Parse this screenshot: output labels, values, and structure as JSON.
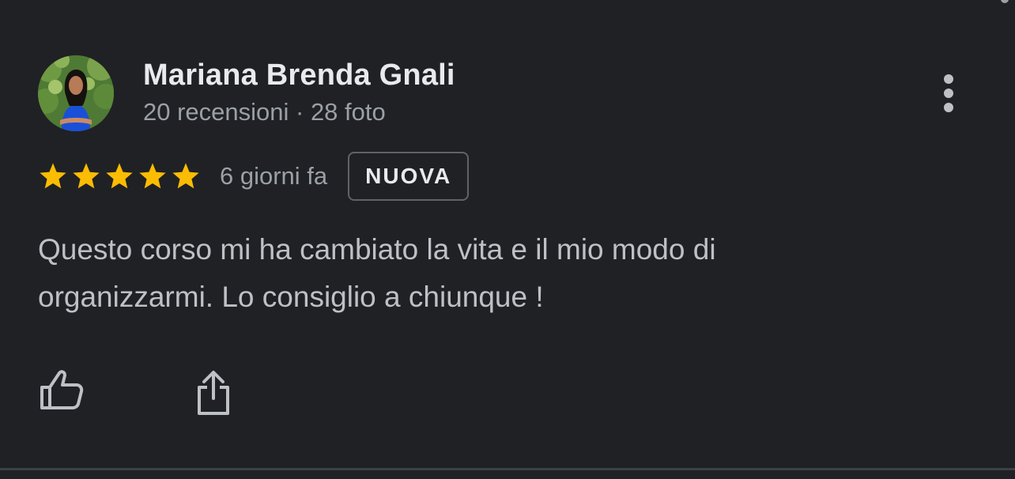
{
  "review": {
    "reviewer_name": "Mariana Brenda Gnali",
    "reviewer_meta": "20 recensioni · 28 foto",
    "rating": 5,
    "rating_max": 5,
    "time": "6 giorni fa",
    "badge": "NUOVA",
    "text": "Questo corso mi ha cambiato la vita e il mio modo di organizzarmi. Lo consiglio a chiunque !"
  },
  "icons": {
    "more": "more-vertical-icon",
    "like": "thumb-up-icon",
    "share": "share-icon",
    "star": "star-icon"
  },
  "colors": {
    "background": "#202124",
    "star": "#fbbc04",
    "primary_text": "#e8eaed",
    "secondary_text": "#9aa0a6"
  }
}
